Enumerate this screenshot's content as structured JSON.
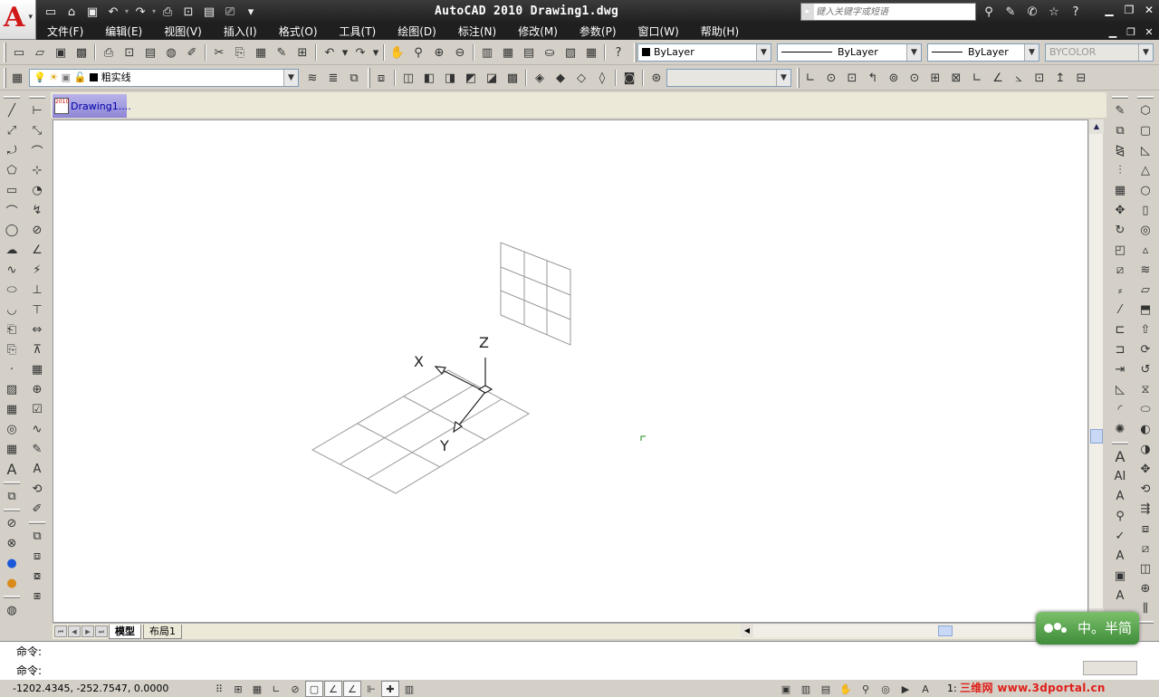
{
  "app": {
    "title": "AutoCAD 2010  Drawing1.dwg",
    "logo_letter": "A",
    "search_placeholder": "键入关键字或短语"
  },
  "quick_access": [
    "new-icon",
    "open-icon",
    "save-icon",
    "undo-icon",
    "redo-icon",
    "print-icon",
    "preview-icon",
    "publish-icon",
    "plot-icon"
  ],
  "menu": [
    "文件(F)",
    "编辑(E)",
    "视图(V)",
    "插入(I)",
    "格式(O)",
    "工具(T)",
    "绘图(D)",
    "标注(N)",
    "修改(M)",
    "参数(P)",
    "窗口(W)",
    "帮助(H)"
  ],
  "properties": {
    "color": "ByLayer",
    "linetype": "ByLayer",
    "lineweight": "ByLayer",
    "plotstyle": "BYCOLOR"
  },
  "layer": {
    "current": "粗实线"
  },
  "document_tab": {
    "label": "Drawing1....",
    "icon_text": "2010"
  },
  "layout_tabs": [
    "模型",
    "布局1"
  ],
  "command": {
    "history": "命令:",
    "prompt": "命令:"
  },
  "status": {
    "coordinates": "-1202.4345, -252.7547, 0.0000",
    "scale": "1:"
  },
  "ucs": {
    "x_label": "X",
    "y_label": "Y",
    "z_label": "Z"
  },
  "watermark": {
    "badge": "中。半简",
    "site": "三维网 www.3dportal.cn"
  },
  "colors": {
    "title_bar": "#1f1f1f",
    "canvas": "#ffffff",
    "grid_lines": "#9a9a9a",
    "axis_lines": "#222222",
    "brand_red": "#d01818"
  }
}
